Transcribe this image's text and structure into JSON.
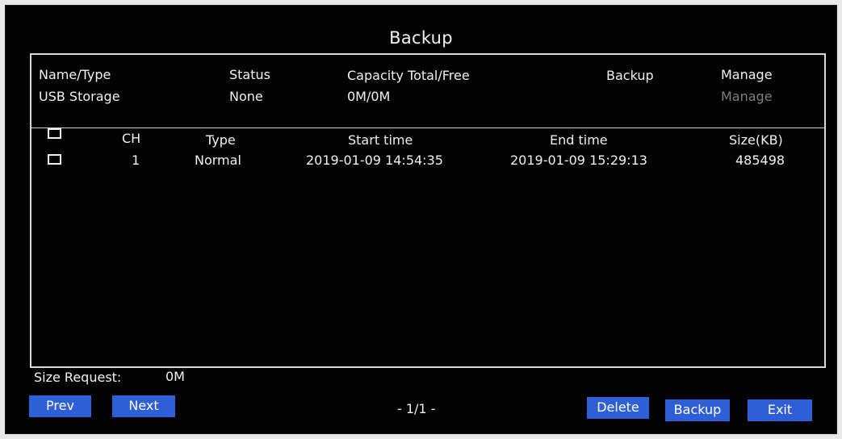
{
  "window": {
    "title": "Backup"
  },
  "device_table": {
    "headers": {
      "name_type": "Name/Type",
      "status": "Status",
      "capacity": "Capacity Total/Free",
      "backup": "Backup",
      "manage": "Manage"
    },
    "row": {
      "name": "USB Storage",
      "status": "None",
      "capacity": "0M/0M",
      "backup": "",
      "manage": "Manage"
    }
  },
  "file_table": {
    "headers": {
      "checkbox": "",
      "ch": "CH",
      "type": "Type",
      "start_time": "Start time",
      "end_time": "End time",
      "size": "Size(KB)"
    },
    "rows": [
      {
        "checked": false,
        "ch": "1",
        "type": "Normal",
        "start_time": "2019-01-09 14:54:35",
        "end_time": "2019-01-09 15:29:13",
        "size": "485498"
      }
    ]
  },
  "footer": {
    "size_request_label": "Size Request:",
    "size_request_value": "0M",
    "prev_label": "Prev",
    "next_label": "Next",
    "page_indicator": "- 1/1 -",
    "delete_label": "Delete",
    "backup_label": "Backup",
    "exit_label": "Exit"
  },
  "colors": {
    "background": "#030303",
    "foreground": "#f0f0f0",
    "button": "#2f5fd6",
    "disabled": "#7e7e7e"
  }
}
